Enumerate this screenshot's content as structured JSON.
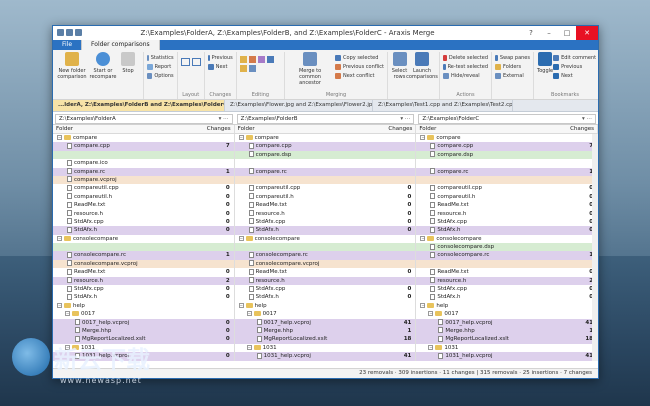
{
  "window": {
    "title": "Z:\\Examples\\FolderA, Z:\\Examples\\FolderB, and Z:\\Examples\\FolderC - Araxis Merge",
    "help": "?"
  },
  "ribbon_tabs": [
    "File",
    "Folder comparisons"
  ],
  "ribbon": {
    "new_folder_comparison": "New folder comparison",
    "start_or_recompare": "Start or recompare",
    "stop": "Stop",
    "statistics": "Statistics",
    "report": "Report",
    "options": "Options",
    "previous": "Previous",
    "next": "Next",
    "merge_to_common_ancestor": "Merge to common ancestor",
    "copy_selected": "Copy selected",
    "previous_conflict": "Previous conflict",
    "next_conflict": "Next conflict",
    "select_rows": "Select rows",
    "launch_comparisons": "Launch comparisons",
    "delete_selected": "Delete selected",
    "re_test_selected": "Re-test selected",
    "hide_reveal": "Hide/reveal",
    "swap_panes": "Swap panes",
    "folders": "Folders",
    "external": "External",
    "toggle": "Toggle",
    "edit_comment": "Edit comment",
    "bm_previous": "Previous",
    "bm_next": "Next",
    "groups": [
      "Layout",
      "Changes",
      "Editing",
      "Merging",
      "Actions",
      "Bookmarks"
    ]
  },
  "doc_tabs": [
    "...lderA, Z:\\Examples\\FolderB and Z:\\Examples\\FolderC",
    "Z:\\Examples\\Flower.jpg and Z:\\Examples\\Flower2.jpg",
    "Z:\\Examples\\Test1.cpp and Z:\\Examples\\Test2.cpp"
  ],
  "paths": [
    "Z:\\Examples\\FolderA",
    "Z:\\Examples\\FolderB",
    "Z:\\Examples\\FolderC"
  ],
  "columns": {
    "folder": "Folder",
    "changes": "Changes"
  },
  "rows": [
    {
      "a": "compare",
      "b": "compare",
      "c": "compare",
      "type": "folder",
      "bg": ""
    },
    {
      "a": "compare.cpp",
      "an": "7",
      "b": "compare.cpp",
      "bn": "",
      "c": "compare.cpp",
      "cn": "7",
      "bg": "purple"
    },
    {
      "a": "",
      "b": "compare.dsp",
      "c": "compare.dsp",
      "bg": "green"
    },
    {
      "a": "compare.ico",
      "b": "",
      "c": "",
      "bg": ""
    },
    {
      "a": "compare.rc",
      "an": "1",
      "b": "compare.rc",
      "c": "compare.rc",
      "cn": "1",
      "bg": "purple"
    },
    {
      "a": "compare.vcproj",
      "b": "",
      "c": "",
      "bg": "orange"
    },
    {
      "a": "compareutil.cpp",
      "an": "0",
      "b": "compareutil.cpp",
      "bn": "0",
      "c": "compareutil.cpp",
      "cn": "0",
      "bg": ""
    },
    {
      "a": "compareutil.h",
      "an": "0",
      "b": "compareutil.h",
      "bn": "0",
      "c": "compareutil.h",
      "cn": "0",
      "bg": ""
    },
    {
      "a": "ReadMe.txt",
      "an": "0",
      "b": "ReadMe.txt",
      "bn": "0",
      "c": "ReadMe.txt",
      "cn": "0",
      "bg": ""
    },
    {
      "a": "resource.h",
      "an": "0",
      "b": "resource.h",
      "bn": "0",
      "c": "resource.h",
      "cn": "0",
      "bg": ""
    },
    {
      "a": "StdAfx.cpp",
      "an": "0",
      "b": "StdAfx.cpp",
      "bn": "0",
      "c": "StdAfx.cpp",
      "cn": "0",
      "bg": ""
    },
    {
      "a": "StdAfx.h",
      "an": "0",
      "b": "StdAfx.h",
      "bn": "0",
      "c": "StdAfx.h",
      "cn": "0",
      "bg": "purple"
    },
    {
      "a": "consolecompare",
      "b": "consolecompare",
      "c": "consolecompare",
      "type": "folder",
      "bg": ""
    },
    {
      "a": "",
      "b": "",
      "c": "consolecompare.dsp",
      "bg": "green"
    },
    {
      "a": "consolecompare.rc",
      "an": "1",
      "b": "consolecompare.rc",
      "bn": "",
      "c": "consolecompare.rc",
      "cn": "1",
      "bg": "purple"
    },
    {
      "a": "consolecompare.vcproj",
      "b": "consolecompare.vcproj",
      "c": "",
      "bg": "orange"
    },
    {
      "a": "ReadMe.txt",
      "an": "0",
      "b": "ReadMe.txt",
      "bn": "0",
      "c": "ReadMe.txt",
      "cn": "0",
      "bg": ""
    },
    {
      "a": "resource.h",
      "an": "2",
      "b": "resource.h",
      "c": "resource.h",
      "cn": "2",
      "bg": "purple"
    },
    {
      "a": "StdAfx.cpp",
      "an": "0",
      "b": "StdAfx.cpp",
      "bn": "0",
      "c": "StdAfx.cpp",
      "cn": "0",
      "bg": ""
    },
    {
      "a": "StdAfx.h",
      "an": "0",
      "b": "StdAfx.h",
      "bn": "0",
      "c": "StdAfx.h",
      "cn": "0",
      "bg": ""
    },
    {
      "a": "help",
      "b": "help",
      "c": "help",
      "type": "folder",
      "bg": ""
    },
    {
      "a": "0017",
      "b": "0017",
      "c": "0017",
      "type": "folder",
      "bg": ""
    },
    {
      "a": "0017_help.vcproj",
      "an": "0",
      "b": "0017_help.vcproj",
      "bn": "41",
      "c": "0017_help.vcproj",
      "cn": "41",
      "bg": "purple"
    },
    {
      "a": "Merge.hhp",
      "an": "0",
      "b": "Merge.hhp",
      "bn": "1",
      "c": "Merge.hhp",
      "cn": "1",
      "bg": "purple"
    },
    {
      "a": "MgReportLocalized.xslt",
      "an": "0",
      "b": "MgReportLocalized.xslt",
      "bn": "18",
      "c": "MgReportLocalized.xslt",
      "cn": "18",
      "bg": "purple"
    },
    {
      "a": "1031",
      "b": "1031",
      "c": "1031",
      "type": "folder",
      "bg": ""
    },
    {
      "a": "1031_help.vcproj",
      "an": "0",
      "b": "1031_help.vcproj",
      "bn": "41",
      "c": "1031_help.vcproj",
      "cn": "41",
      "bg": "purple"
    }
  ],
  "status": "23 removals · 309 insertions · 11 changes | 315 removals · 25 insertions · 7 changes",
  "watermark": {
    "name": "新云下载",
    "url": "www.newasp.net"
  }
}
